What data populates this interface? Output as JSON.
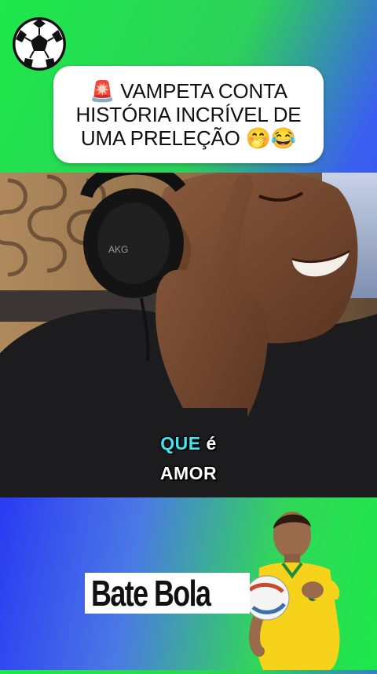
{
  "header": {
    "title_lines": [
      "🚨 VAMPETA CONTA",
      "HISTÓRIA INCRÍVEL DE",
      "UMA PRELEÇÃO 🤭😂"
    ]
  },
  "video": {
    "caption_line1_highlight": "QUE",
    "caption_line1_rest": "é",
    "caption_line2": "AMOR",
    "headphones_brand": "AKG"
  },
  "footer": {
    "brand_text": "Bate Bola"
  },
  "colors": {
    "bg_green": "#1ee84a",
    "bg_blue": "#2f3ff5",
    "caption_highlight": "#40e6f2",
    "jersey_yellow": "#f6d21b"
  },
  "icons": [
    "soccer-ball-icon",
    "siren-emoji",
    "hand-over-mouth-emoji",
    "laughing-emoji"
  ]
}
